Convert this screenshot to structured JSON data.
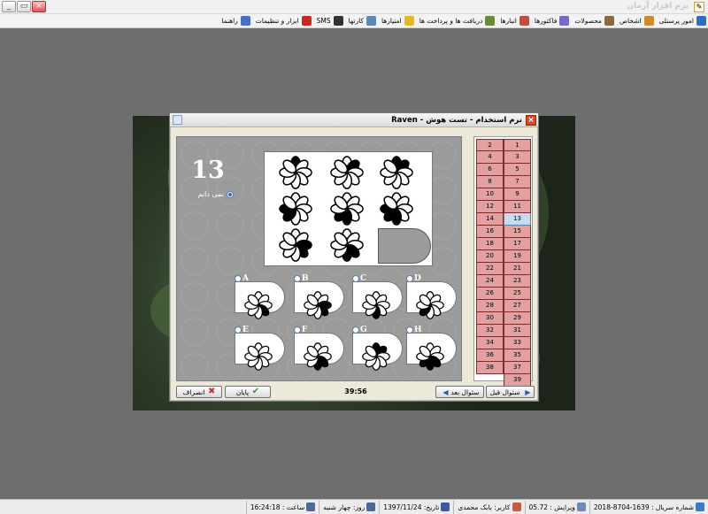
{
  "window": {
    "title": "نرم افزار آرمان"
  },
  "menu": [
    {
      "label": "امور پرسنلی",
      "icon": "personnel-icon",
      "color": "#2e6fc2"
    },
    {
      "label": "اشخاص",
      "icon": "people-icon",
      "color": "#d08a2a"
    },
    {
      "label": "محصولات",
      "icon": "products-icon",
      "color": "#8a6a3a"
    },
    {
      "label": "فاکتورها",
      "icon": "invoice-icon",
      "color": "#7a6acb"
    },
    {
      "label": "انبارها",
      "icon": "warehouse-icon",
      "color": "#c84a3a"
    },
    {
      "label": "دریافت ها و پرداخت ها",
      "icon": "payments-icon",
      "color": "#6a8a3a"
    },
    {
      "label": "امتیازها",
      "icon": "star-icon",
      "color": "#e8b820"
    },
    {
      "label": "کارتها",
      "icon": "cards-icon",
      "color": "#5a8ab4"
    },
    {
      "label": "SMS",
      "icon": "sms-icon",
      "color": "#333333"
    },
    {
      "label": "ابزار و تنظیمات",
      "icon": "tools-icon",
      "color": "#c8281e"
    },
    {
      "label": "راهنما",
      "icon": "help-icon",
      "color": "#4a6fc4"
    }
  ],
  "dialog": {
    "title": "نرم استخدام - تست هوش - Raven",
    "question_number": "13",
    "dont_know_label": "نمی دانم",
    "option_letters": [
      "A",
      "B",
      "C",
      "D",
      "E",
      "F",
      "G",
      "H"
    ],
    "question_grid": {
      "rows": 6,
      "col1": [
        "1",
        "3",
        "5",
        "7",
        "9",
        "11",
        "13",
        "15",
        "17",
        "19",
        "21",
        "23",
        "25",
        "27",
        "29",
        "31",
        "33",
        "35",
        "37",
        "39"
      ],
      "col2": [
        "2",
        "4",
        "6",
        "8",
        "10",
        "12",
        "14",
        "16",
        "18",
        "20",
        "22",
        "24",
        "26",
        "28",
        "30",
        "32",
        "34",
        "36",
        "38"
      ],
      "current": "13"
    },
    "buttons": {
      "cancel": "انصراف",
      "finish": "پایان",
      "next": "سئوال بعد",
      "prev": "سئوال قبل"
    },
    "timer": "39:56"
  },
  "status": [
    {
      "label": "شماره سریال : 1639-8704-2018",
      "icon": "globe-icon",
      "color": "#3a78c8"
    },
    {
      "label": "ویرایش : 05.72",
      "icon": "edit-icon",
      "color": "#6a8ab8"
    },
    {
      "label": "کاربر: بابک محمدی",
      "icon": "user-icon",
      "color": "#c85a3a"
    },
    {
      "label": "تاریخ: 1397/11/24",
      "icon": "calendar-icon",
      "color": "#3a5a9a"
    },
    {
      "label": "روز: چهار شنبه",
      "icon": "day-icon",
      "color": "#4a6a9a"
    },
    {
      "label": "ساعت : 16:24:18",
      "icon": "clock-icon",
      "color": "#4a6a9a"
    }
  ],
  "colors": {
    "grid_cell": "#e3a0a0",
    "grid_current": "#c5dcf2",
    "dialog_bg": "#ece9d8",
    "panel_bg": "#9b9b9b"
  }
}
